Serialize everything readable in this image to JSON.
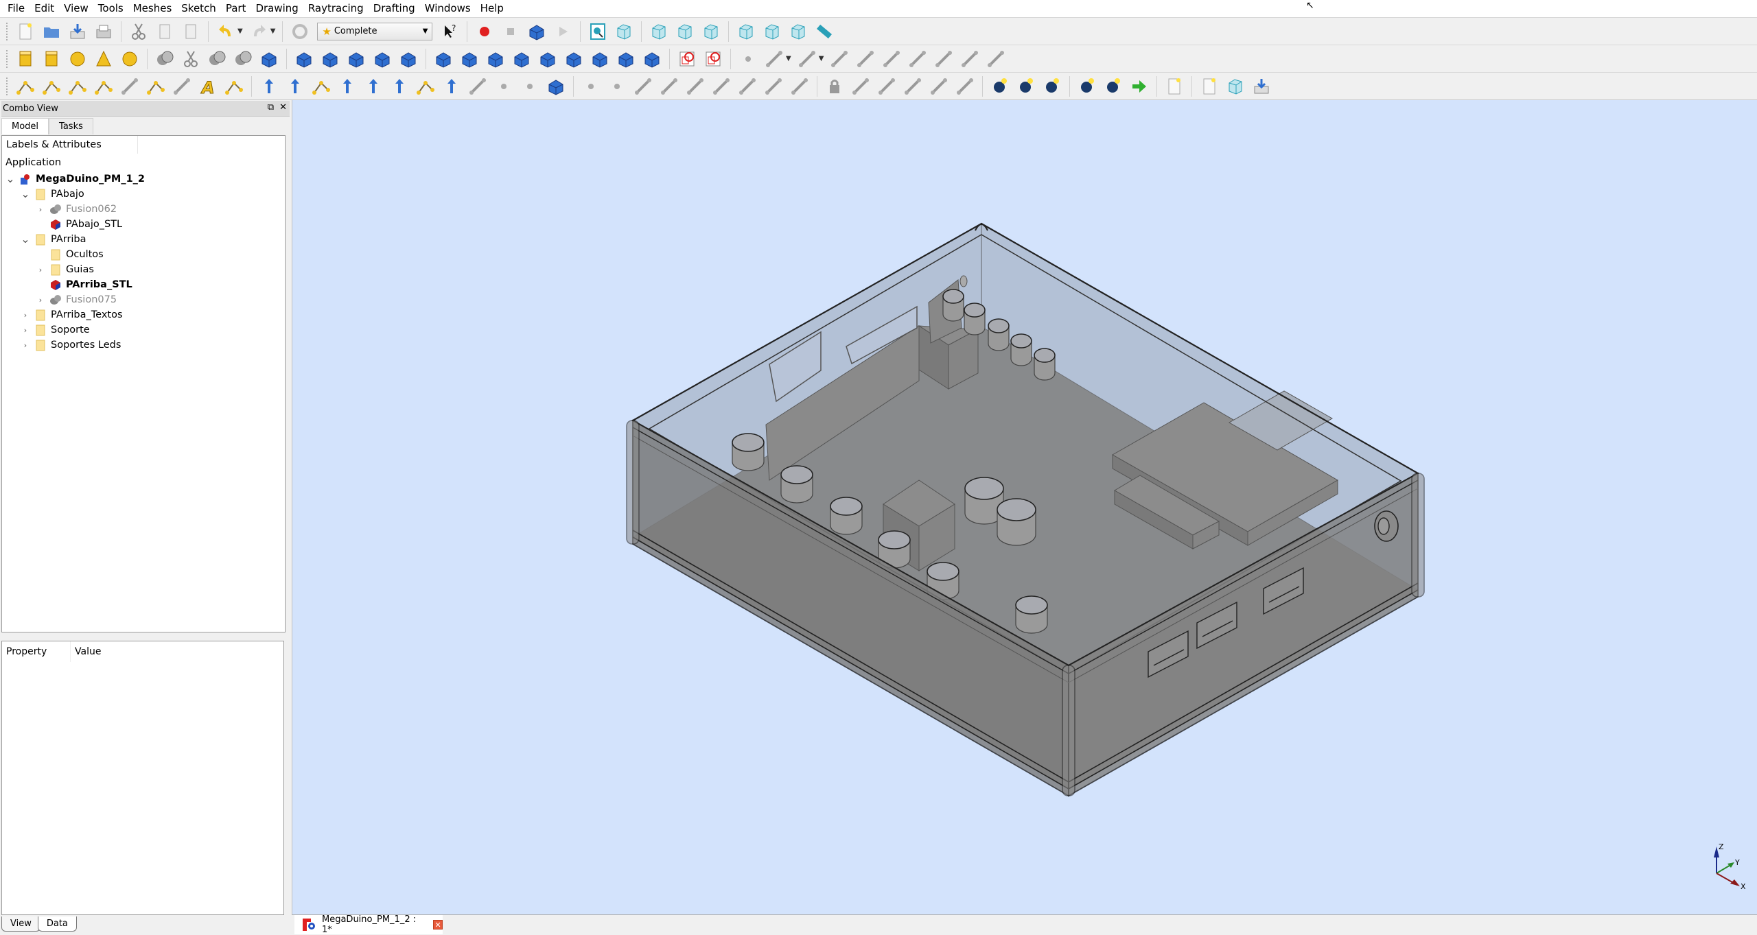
{
  "menu": [
    "File",
    "Edit",
    "View",
    "Tools",
    "Meshes",
    "Sketch",
    "Part",
    "Drawing",
    "Raytracing",
    "Drafting",
    "Windows",
    "Help"
  ],
  "toolbar": {
    "workbench_selector": {
      "value": "Complete",
      "icon": "star-icon"
    },
    "row1_icons": [
      "new-document-icon",
      "open-folder-icon",
      "save-icon",
      "print-icon",
      "cut-icon",
      "copy-icon",
      "paste-icon",
      "undo-icon",
      "redo-icon",
      "refresh-icon",
      "whats-this-icon",
      "record-macro-icon",
      "stop-macro-icon",
      "edit-macro-icon",
      "run-macro-icon",
      "fit-all-icon",
      "isometric-view-icon",
      "front-view-icon",
      "top-view-icon",
      "right-view-icon",
      "rear-view-icon",
      "bottom-view-icon",
      "left-view-icon",
      "measure-icon"
    ],
    "row2_icons": [
      "box-icon",
      "cylinder-icon",
      "sphere-icon",
      "cone-icon",
      "torus-icon",
      "union-icon",
      "cut-icon",
      "fuse-icon",
      "intersection-icon",
      "shape-builder-icon",
      "extrude-icon",
      "revolve-icon",
      "mirror-icon",
      "fillet-icon",
      "chamfer-icon",
      "face-icon",
      "thickness-icon",
      "offset-icon",
      "loft-icon",
      "sweep-icon",
      "section-icon",
      "cross-sections-icon",
      "compound-icon",
      "explode-compound-icon",
      "new-sketch-icon",
      "leave-sketch-icon",
      "point-icon",
      "arc-icon",
      "circle-icon",
      "line-icon",
      "polyline-icon",
      "rectangle-icon",
      "fillet-sketch-icon",
      "trim-icon",
      "external-geometry-icon",
      "construction-mode-icon"
    ],
    "row3_icons": [
      "line-draft-icon",
      "wire-icon",
      "circle-draft-icon",
      "arc-draft-icon",
      "rectangle-draft-icon",
      "polygon-draft-icon",
      "bspline-icon",
      "text-icon",
      "dimension-icon",
      "move-icon",
      "rotate-icon",
      "offset-draft-icon",
      "upgrade-icon",
      "downgrade-icon",
      "scale-icon",
      "edit-draft-icon",
      "shape2dview-icon",
      "wire-to-bspline-icon",
      "add-point-icon",
      "remove-point-icon",
      "working-plane-icon",
      "coincident-icon",
      "point-on-object-icon",
      "vertical-icon",
      "horizontal-icon",
      "parallel-icon",
      "perpendicular-icon",
      "tangent-icon",
      "equal-icon",
      "symmetric-icon",
      "lock-icon",
      "horizontal-distance-icon",
      "vertical-distance-icon",
      "distance-icon",
      "radius-icon",
      "angle-icon",
      "import-3d-icon",
      "export-part-icon",
      "toggle-icon",
      "povray-project-icon",
      "povray-insert-icon",
      "export-arrow-icon",
      "new-drawing-icon",
      "a3-page-icon",
      "insert-view-icon",
      "export-page-icon"
    ]
  },
  "combo_view": {
    "title": "Combo View",
    "tabs": [
      {
        "label": "Model",
        "active": true
      },
      {
        "label": "Tasks",
        "active": false
      }
    ],
    "tree": {
      "header": "Labels & Attributes",
      "application_label": "Application",
      "items": [
        {
          "label": "MegaDuino_PM_1_2",
          "depth": 0,
          "expander": "open",
          "icon": "document-icon",
          "style": "bold"
        },
        {
          "label": "PAbajo",
          "depth": 1,
          "expander": "open",
          "icon": "folder-icon",
          "style": "normal"
        },
        {
          "label": "Fusion062",
          "depth": 2,
          "expander": "closed",
          "icon": "fusion-icon",
          "style": "muted"
        },
        {
          "label": "PAbajo_STL",
          "depth": 2,
          "expander": "none",
          "icon": "mesh-icon",
          "style": "normal"
        },
        {
          "label": "PArriba",
          "depth": 1,
          "expander": "open",
          "icon": "folder-icon",
          "style": "normal"
        },
        {
          "label": "Ocultos",
          "depth": 2,
          "expander": "none",
          "icon": "folder-icon",
          "style": "normal"
        },
        {
          "label": "Guias",
          "depth": 2,
          "expander": "closed",
          "icon": "folder-icon",
          "style": "normal"
        },
        {
          "label": "PArriba_STL",
          "depth": 2,
          "expander": "none",
          "icon": "mesh-icon",
          "style": "bold"
        },
        {
          "label": "Fusion075",
          "depth": 2,
          "expander": "closed",
          "icon": "fusion-icon",
          "style": "muted"
        },
        {
          "label": "PArriba_Textos",
          "depth": 1,
          "expander": "closed",
          "icon": "folder-icon",
          "style": "normal"
        },
        {
          "label": "Soporte",
          "depth": 1,
          "expander": "closed",
          "icon": "folder-icon",
          "style": "normal"
        },
        {
          "label": "Soportes Leds",
          "depth": 1,
          "expander": "closed",
          "icon": "folder-icon",
          "style": "normal"
        }
      ]
    },
    "properties": {
      "col_property": "Property",
      "col_value": "Value"
    },
    "bottom_tabs": [
      {
        "label": "View",
        "active": false
      },
      {
        "label": "Data",
        "active": true
      }
    ]
  },
  "viewport": {
    "background": "#d3e3fc",
    "model_fill": "#808080",
    "axis": {
      "x_label": "X",
      "y_label": "Y",
      "z_label": "Z",
      "x_color": "#8b1a1a",
      "y_color": "#2a8a2a",
      "z_color": "#1a2a8a"
    }
  },
  "document_tab": {
    "label": "MegaDuino_PM_1_2 : 1*"
  }
}
